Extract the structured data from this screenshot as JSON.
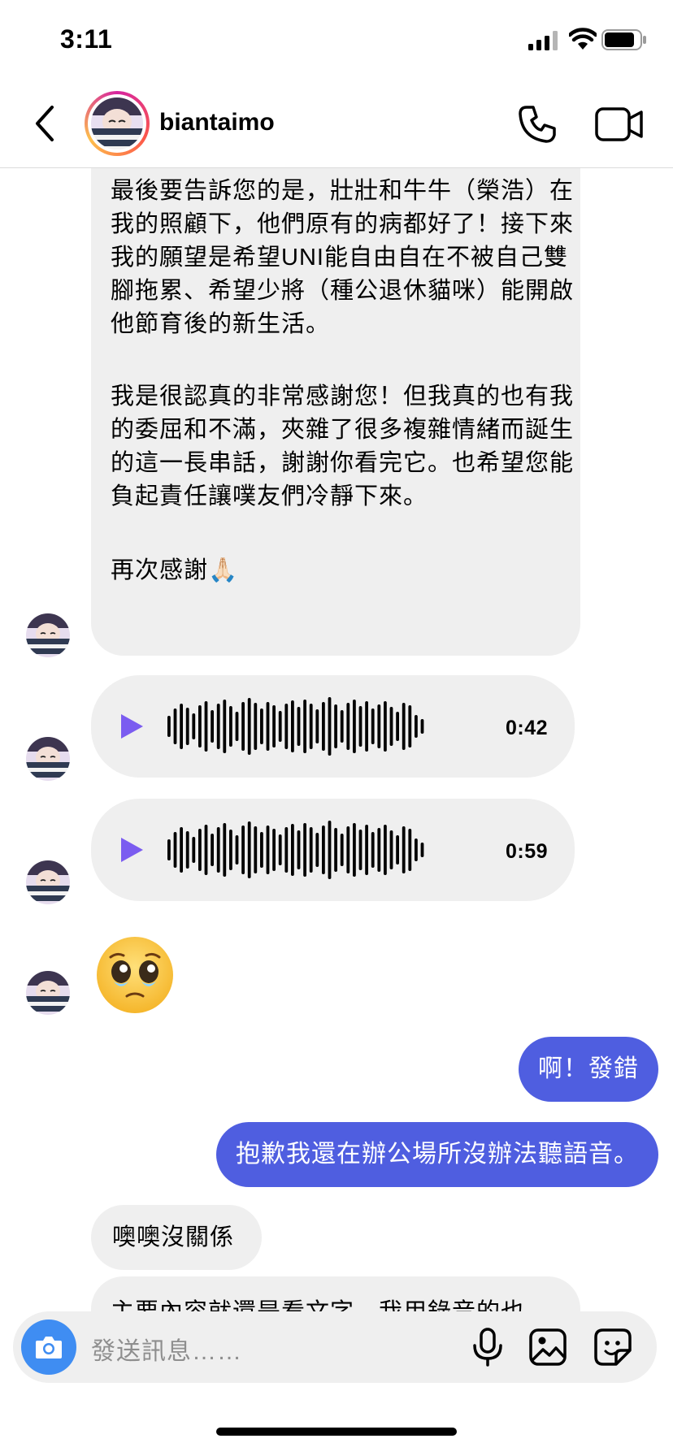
{
  "status": {
    "time": "3:11",
    "icons": [
      "cellular-signal-icon",
      "wifi-icon",
      "battery-icon"
    ]
  },
  "header": {
    "username": "biantaimo",
    "icons": [
      "back-chevron-icon",
      "phone-icon",
      "video-camera-icon"
    ]
  },
  "messages": {
    "long_paragraphs": [
      "最後要告訴您的是，壯壯和牛牛（榮浩）在我的照顧下，他們原有的病都好了！接下來我的願望是希望UNI能自由自在不被自己雙腳拖累、希望少將（種公退休貓咪）能開啟他節育後的新生活。",
      "我是很認真的非常感謝您！但我真的也有我的委屈和不滿，夾雜了很多複雜情緒而誕生的這一長串話，謝謝你看完它。也希望您能負起責任讓噗友們冷靜下來。",
      "再次感謝🙏🏻"
    ],
    "voice_1_duration": "0:42",
    "voice_2_duration": "0:59",
    "emoji": "pleading-face-emoji",
    "sent_1": "啊！發錯",
    "sent_2": "抱歉我還在辦公場所沒辦法聽語音。",
    "recv_1": "噢噢沒關係",
    "recv_2_partial": "主要內容就還是看文字，我用錄音的也"
  },
  "composer": {
    "placeholder": "發送訊息……",
    "icons": [
      "camera-icon",
      "microphone-icon",
      "gallery-icon",
      "sticker-icon"
    ]
  },
  "colors": {
    "sent_bubble": "#4f5ee0",
    "received_bubble": "#efefef",
    "play_icon": "#7b5cf0",
    "camera_button": "#3f8df2"
  },
  "voice_waveform": [
    26,
    44,
    56,
    46,
    32,
    52,
    62,
    40,
    56,
    66,
    50,
    36,
    60,
    70,
    58,
    44,
    60,
    52,
    38,
    56,
    64,
    48,
    66,
    56,
    42,
    60,
    72,
    54,
    40,
    58,
    66,
    50,
    62,
    44,
    54,
    62,
    48,
    36,
    58,
    52,
    28,
    18
  ]
}
